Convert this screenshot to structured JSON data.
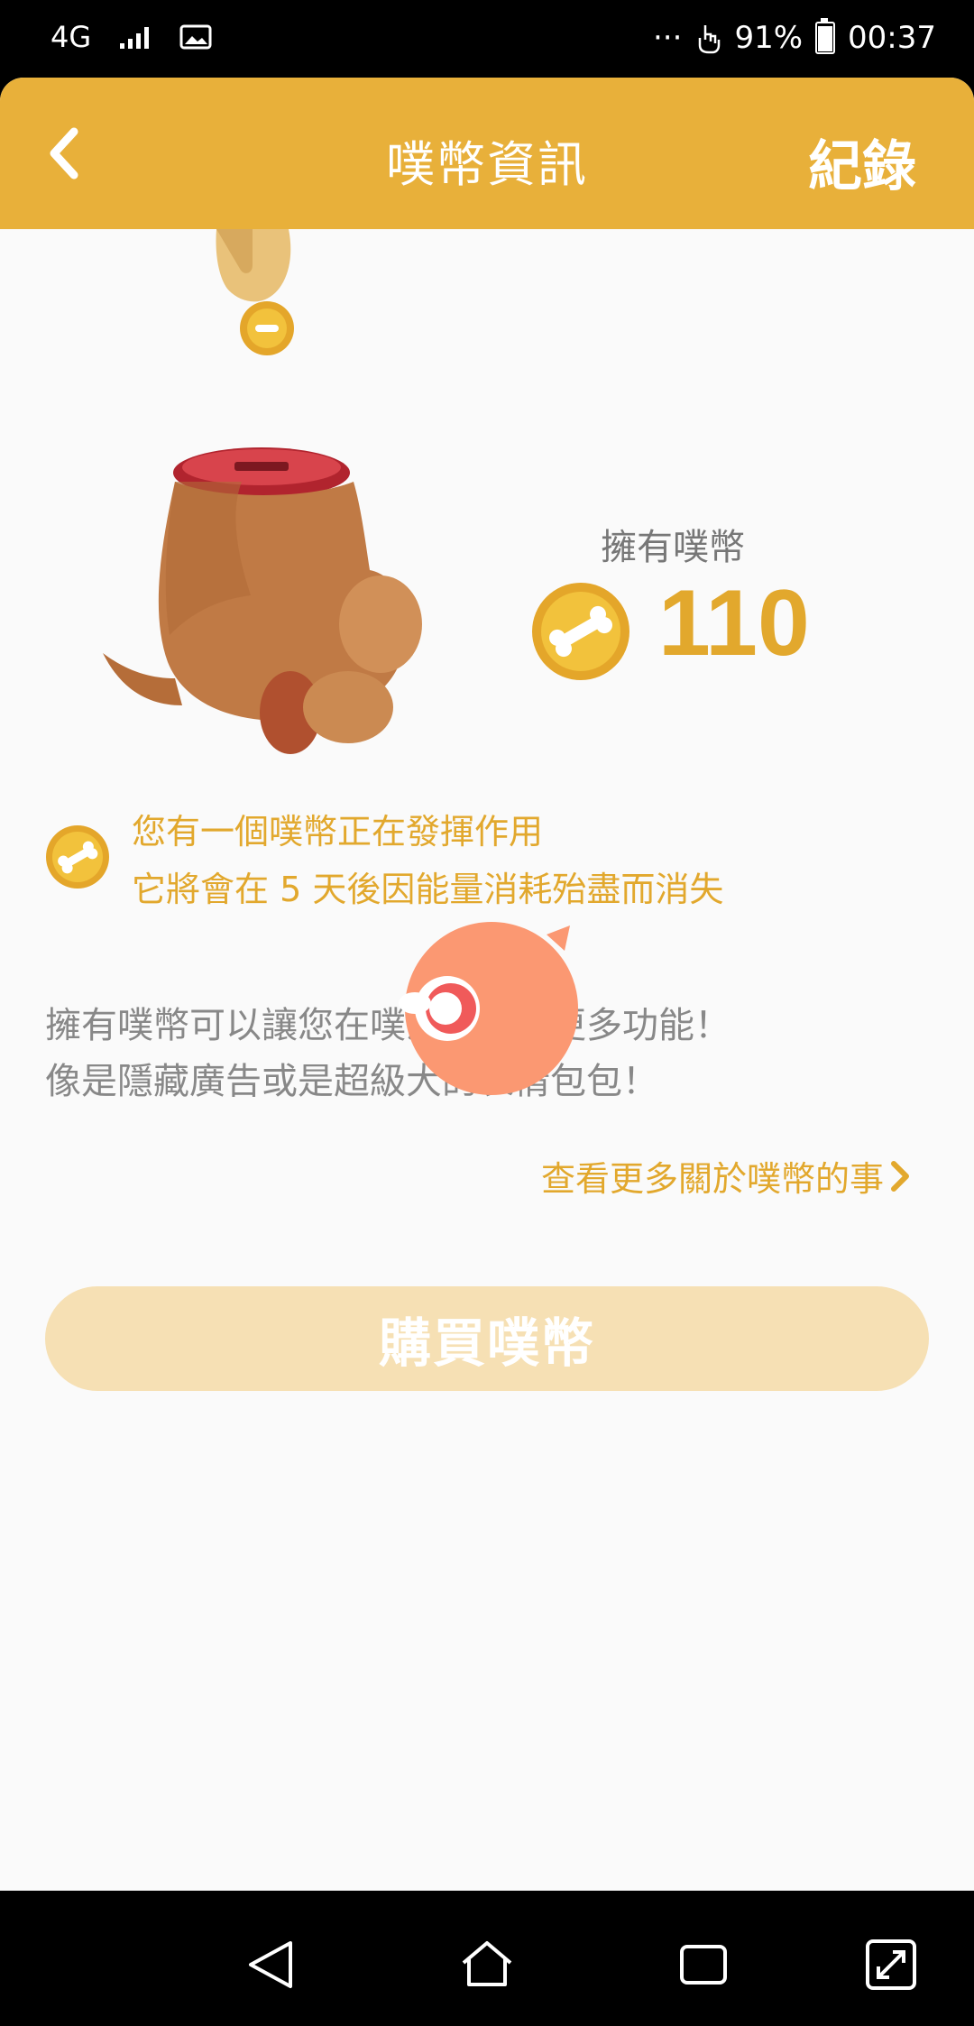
{
  "status_bar": {
    "network": "4G",
    "ellipsis": "···",
    "battery_percent": "91%",
    "time": "00:37"
  },
  "header": {
    "title": "噗幣資訊",
    "record_label": "紀錄"
  },
  "balance": {
    "label": "擁有噗幣",
    "count": "110"
  },
  "notice": {
    "line1": "您有一個噗幣正在發揮作用",
    "line2": "它將會在 5 天後因能量消耗殆盡而消失"
  },
  "description": {
    "line1": "擁有噗幣可以讓您在噗浪上使用更多功能！",
    "line2": "像是隱藏廣告或是超級大的表情包包！"
  },
  "more_link": "查看更多關於噗幣的事",
  "buy_button": "購買噗幣",
  "colors": {
    "brand": "#e8b03a",
    "accent_text": "#e2a82d",
    "buy_button_bg": "#f6e0b4",
    "page_bg": "#fafafa"
  },
  "icons": {
    "back": "chevron-left-icon",
    "coin": "bone-coin-icon",
    "more": "chevron-right-icon"
  }
}
